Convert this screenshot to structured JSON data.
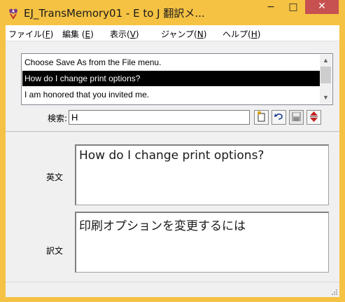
{
  "window": {
    "title": "EJ_TransMemory01 - E to J 翻訳メ...",
    "min_glyph": "−",
    "max_glyph": "□",
    "close_glyph": "✕"
  },
  "menu": [
    {
      "label": "ファイル(",
      "key": "F",
      "tail": ")"
    },
    {
      "label": "編集 (",
      "key": "E",
      "tail": ")"
    },
    {
      "label": "表示(",
      "key": "V",
      "tail": ")"
    },
    {
      "label": "ジャンプ(",
      "key": "N",
      "tail": ")"
    },
    {
      "label": "ヘルプ(",
      "key": "H",
      "tail": ")"
    }
  ],
  "list": {
    "items": [
      "Choose Save As from the File menu.",
      "How do I change print options?",
      "I am honored that you invited me."
    ],
    "selected_index": 1
  },
  "search": {
    "label": "検索:",
    "value": "H"
  },
  "fields": {
    "english_label": "英文",
    "english_text": "How do I change print options?",
    "translation_label": "訳文",
    "translation_text": "印刷オプションを変更するには"
  },
  "colors": {
    "title_bar": "#f5c243",
    "close_button": "#c75050",
    "selection": "#000000"
  },
  "icons": {
    "app": "ej-dictionary-icon",
    "new_entry": "new-entry-icon",
    "undo": "undo-icon",
    "save": "save-icon",
    "move": "up-down-arrows-icon"
  }
}
